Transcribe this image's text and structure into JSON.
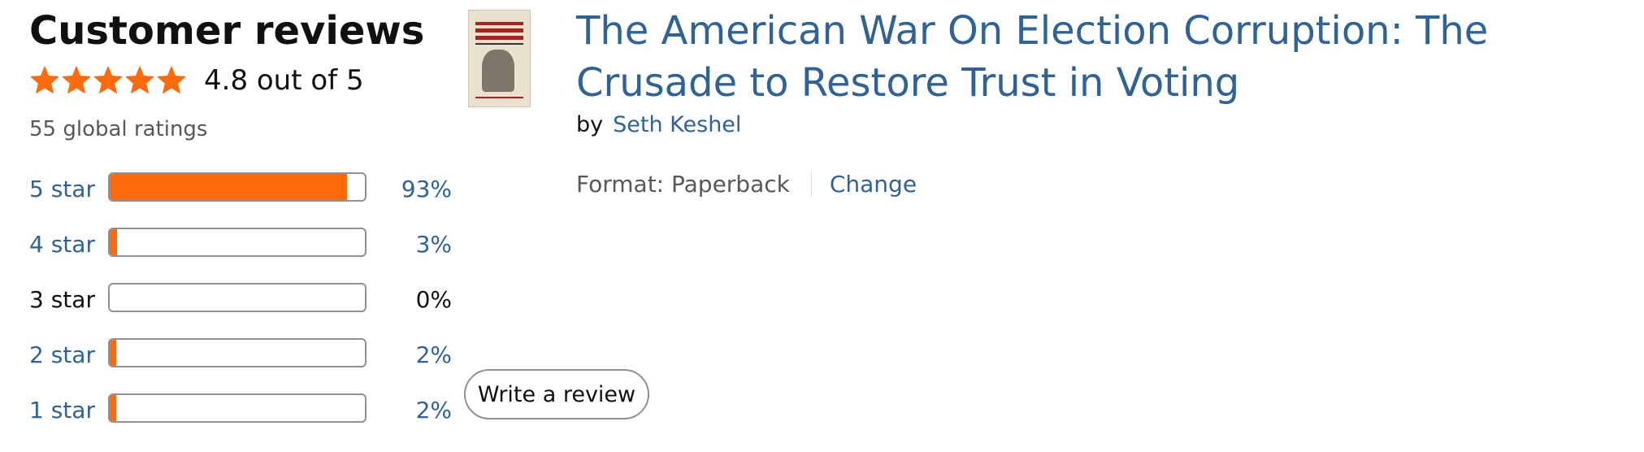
{
  "reviews": {
    "heading": "Customer reviews",
    "rating_value": 4.8,
    "rating_max": 5,
    "rating_text": "4.8 out of 5",
    "global_ratings": "55 global ratings",
    "star_color": "#ff6a0d",
    "histogram": [
      {
        "label": "5 star",
        "percent_text": "93%",
        "percent": 93,
        "is_link": true
      },
      {
        "label": "4 star",
        "percent_text": "3%",
        "percent": 3,
        "is_link": true
      },
      {
        "label": "3 star",
        "percent_text": "0%",
        "percent": 0,
        "is_link": false
      },
      {
        "label": "2 star",
        "percent_text": "2%",
        "percent": 2,
        "is_link": true
      },
      {
        "label": "1 star",
        "percent_text": "2%",
        "percent": 2,
        "is_link": true
      }
    ]
  },
  "product": {
    "title": "The American War On Election Corruption: The Crusade to Restore Trust in Voting",
    "by_label": "by",
    "author": "Seth Keshel",
    "format_text": "Format: Paperback",
    "change_label": "Change"
  },
  "actions": {
    "write_review_label": "Write a review"
  },
  "colors": {
    "link": "#2f6398",
    "bar_fill": "#ff6a0d",
    "text": "#0f1111",
    "muted": "#565959"
  }
}
